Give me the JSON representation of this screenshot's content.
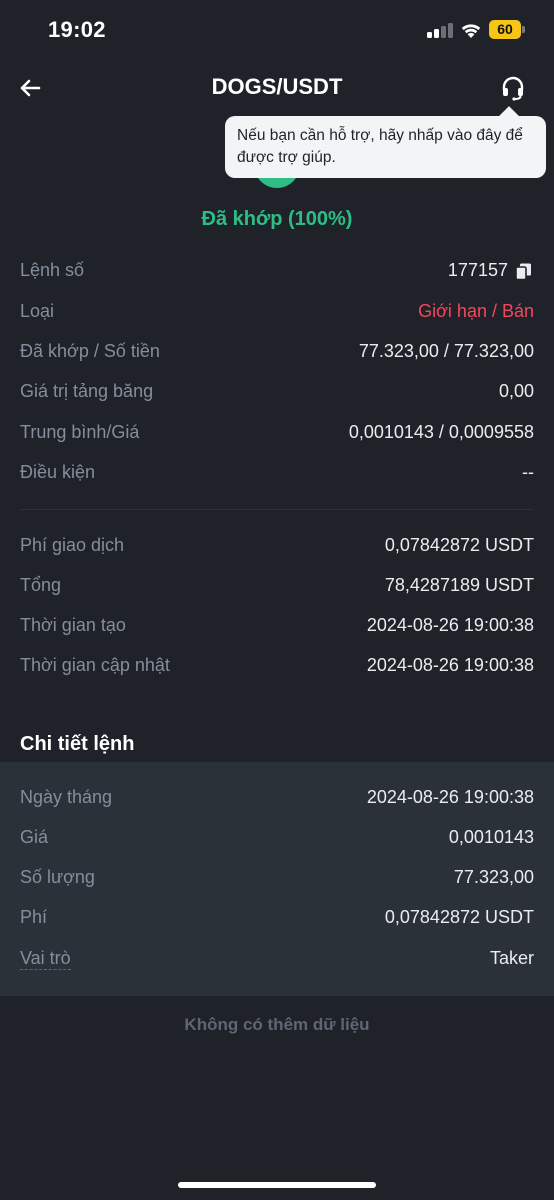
{
  "status_bar": {
    "time": "19:02",
    "battery": "60",
    "battery_color": "#f5c518"
  },
  "header": {
    "title": "DOGS/USDT",
    "back_icon": "arrow-left-icon",
    "support_icon": "headset-icon"
  },
  "tooltip": {
    "text": "Nếu bạn cần hỗ trợ, hãy nhấp vào đây để được trợ giúp."
  },
  "order_status": {
    "label": "Đã khớp (100%)",
    "color": "#2ebd85"
  },
  "order_info": [
    {
      "label": "Lệnh số",
      "value": "177157"
    },
    {
      "label": "Loại",
      "value": "Giới hạn / Bán"
    },
    {
      "label": "Đã khớp / Số tiền",
      "value": "77.323,00 / 77.323,00"
    },
    {
      "label": "Giá trị tảng băng",
      "value": "0,00"
    },
    {
      "label": "Trung bình/Giá",
      "value": "0,0010143 / 0,0009558"
    },
    {
      "label": "Điều kiện",
      "value": "--"
    }
  ],
  "fee_info": [
    {
      "label": "Phí giao dịch",
      "value": "0,07842872 USDT"
    },
    {
      "label": "Tổng",
      "value": "78,4287189 USDT"
    },
    {
      "label": "Thời gian tạo",
      "value": "2024-08-26 19:00:38"
    },
    {
      "label": "Thời gian cập nhật",
      "value": "2024-08-26 19:00:38"
    }
  ],
  "details": {
    "title": "Chi tiết lệnh",
    "rows": [
      {
        "label": "Ngày tháng",
        "value": "2024-08-26 19:00:38"
      },
      {
        "label": "Giá",
        "value": "0,0010143"
      },
      {
        "label": "Số lượng",
        "value": "77.323,00"
      },
      {
        "label": "Phí",
        "value": "0,07842872 USDT"
      },
      {
        "label": "Vai trò",
        "value": "Taker"
      }
    ]
  },
  "footer": {
    "no_more_text": "Không có thêm dữ liệu"
  },
  "colors": {
    "background": "#1f2329",
    "card": "#2b3139",
    "sell_red": "#f6465d",
    "buy_green": "#2ebd85",
    "label_gray": "#848e9c"
  }
}
